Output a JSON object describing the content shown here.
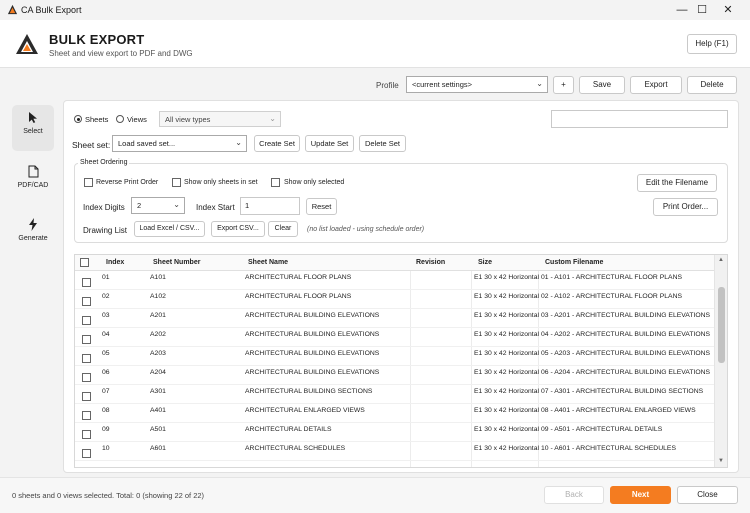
{
  "window": {
    "title": "CA Bulk Export",
    "minimize": "—",
    "maximize": "☐",
    "close": "✕"
  },
  "header": {
    "title": "BULK EXPORT",
    "subtitle": "Sheet and view export to PDF and DWG",
    "help_label": "Help (F1)"
  },
  "toolbar": {
    "profile_label": "Profile",
    "profile_value": "<current settings>",
    "add_label": "+",
    "save_label": "Save",
    "export_label": "Export",
    "delete_label": "Delete"
  },
  "nav": {
    "items": [
      {
        "label": "Select",
        "icon": "cursor-icon"
      },
      {
        "label": "PDF/CAD",
        "icon": "document-icon"
      },
      {
        "label": "Generate",
        "icon": "lightning-icon"
      }
    ]
  },
  "source": {
    "sheets_label": "Sheets",
    "views_label": "Views",
    "view_types": "All view types",
    "search_value": ""
  },
  "sheet_set": {
    "label": "Sheet set:",
    "value": "Load saved set...",
    "create_label": "Create Set",
    "update_label": "Update Set",
    "delete_label": "Delete Set"
  },
  "ordering": {
    "group_label": "Sheet Ordering",
    "reverse_label": "Reverse Print Order",
    "only_in_set_label": "Show only sheets in set",
    "only_selected_label": "Show only selected",
    "edit_filename_label": "Edit the Filename",
    "index_digits_label": "Index Digits",
    "index_digits_value": "2",
    "index_start_label": "Index Start",
    "index_start_value": "1",
    "reset_label": "Reset",
    "print_order_label": "Print Order...",
    "drawing_list_label": "Drawing List",
    "load_excel_label": "Load Excel / CSV...",
    "export_csv_label": "Export CSV...",
    "clear_label": "Clear",
    "list_status": "(no list loaded - using schedule order)"
  },
  "table": {
    "headers": {
      "index": "Index",
      "sheet_number": "Sheet Number",
      "sheet_name": "Sheet Name",
      "revision": "Revision",
      "size": "Size",
      "custom_filename": "Custom Filename"
    },
    "rows": [
      {
        "index": "01",
        "sheet_number": "A101",
        "sheet_name": "ARCHITECTURAL FLOOR PLANS",
        "revision": "",
        "size": "E1 30 x 42 Horizontal",
        "custom_filename": "01 - A101 - ARCHITECTURAL FLOOR PLANS"
      },
      {
        "index": "02",
        "sheet_number": "A102",
        "sheet_name": "ARCHITECTURAL FLOOR PLANS",
        "revision": "",
        "size": "E1 30 x 42 Horizontal",
        "custom_filename": "02 - A102 - ARCHITECTURAL FLOOR PLANS"
      },
      {
        "index": "03",
        "sheet_number": "A201",
        "sheet_name": "ARCHITECTURAL BUILDING ELEVATIONS",
        "revision": "",
        "size": "E1 30 x 42 Horizontal",
        "custom_filename": "03 - A201 - ARCHITECTURAL BUILDING ELEVATIONS"
      },
      {
        "index": "04",
        "sheet_number": "A202",
        "sheet_name": "ARCHITECTURAL BUILDING ELEVATIONS",
        "revision": "",
        "size": "E1 30 x 42 Horizontal",
        "custom_filename": "04 - A202 - ARCHITECTURAL BUILDING ELEVATIONS"
      },
      {
        "index": "05",
        "sheet_number": "A203",
        "sheet_name": "ARCHITECTURAL BUILDING ELEVATIONS",
        "revision": "",
        "size": "E1 30 x 42 Horizontal",
        "custom_filename": "05 - A203 - ARCHITECTURAL BUILDING ELEVATIONS"
      },
      {
        "index": "06",
        "sheet_number": "A204",
        "sheet_name": "ARCHITECTURAL BUILDING ELEVATIONS",
        "revision": "",
        "size": "E1 30 x 42 Horizontal",
        "custom_filename": "06 - A204 - ARCHITECTURAL BUILDING ELEVATIONS"
      },
      {
        "index": "07",
        "sheet_number": "A301",
        "sheet_name": "ARCHITECTURAL BUILDING SECTIONS",
        "revision": "",
        "size": "E1 30 x 42 Horizontal",
        "custom_filename": "07 - A301 - ARCHITECTURAL BUILDING SECTIONS"
      },
      {
        "index": "08",
        "sheet_number": "A401",
        "sheet_name": "ARCHITECTURAL ENLARGED VIEWS",
        "revision": "",
        "size": "E1 30 x 42 Horizontal",
        "custom_filename": "08 - A401 - ARCHITECTURAL ENLARGED VIEWS"
      },
      {
        "index": "09",
        "sheet_number": "A501",
        "sheet_name": "ARCHITECTURAL DETAILS",
        "revision": "",
        "size": "E1 30 x 42 Horizontal",
        "custom_filename": "09 - A501 - ARCHITECTURAL DETAILS"
      },
      {
        "index": "10",
        "sheet_number": "A601",
        "sheet_name": "ARCHITECTURAL SCHEDULES",
        "revision": "",
        "size": "E1 30 x 42 Horizontal",
        "custom_filename": "10 - A601 - ARCHITECTURAL SCHEDULES"
      }
    ]
  },
  "footer": {
    "status": "0 sheets and 0 views selected. Total: 0   (showing 22 of 22)",
    "back_label": "Back",
    "next_label": "Next",
    "close_label": "Close"
  },
  "colors": {
    "accent": "#f47c20",
    "logo_dark": "#2b2b2b"
  }
}
